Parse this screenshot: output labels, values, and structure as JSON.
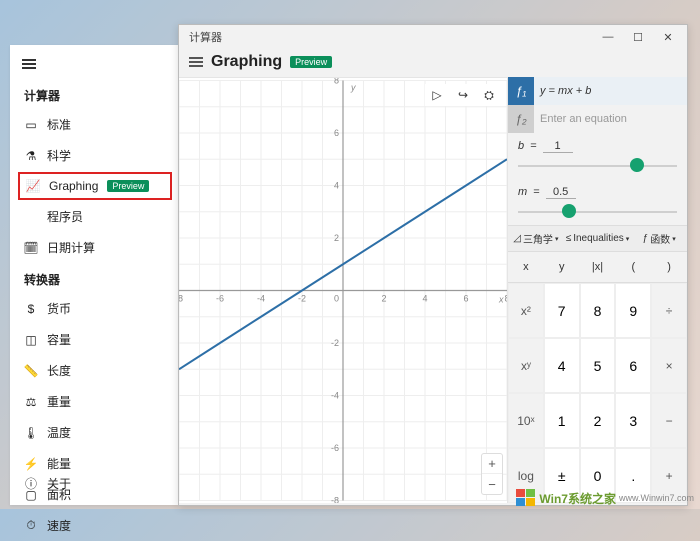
{
  "sidebar": {
    "title": "计算器",
    "items": [
      {
        "icon": "▭",
        "label": "标准",
        "sel": false
      },
      {
        "icon": "⚗",
        "label": "科学",
        "sel": false
      },
      {
        "icon": "📈",
        "label": "Graphing",
        "badge": "Preview",
        "sel": true
      },
      {
        "icon": "</>",
        "label": "程序员",
        "sel": false
      },
      {
        "icon": "🗓",
        "label": "日期计算",
        "sel": false
      }
    ],
    "converter_title": "转换器",
    "converters": [
      {
        "icon": "$",
        "label": "货币"
      },
      {
        "icon": "◫",
        "label": "容量"
      },
      {
        "icon": "📏",
        "label": "长度"
      },
      {
        "icon": "⚖",
        "label": "重量"
      },
      {
        "icon": "🌡",
        "label": "温度"
      },
      {
        "icon": "⚡",
        "label": "能量"
      },
      {
        "icon": "▢",
        "label": "面积"
      },
      {
        "icon": "⏱",
        "label": "速度"
      }
    ],
    "about": {
      "icon": "ⓘ",
      "label": "关于"
    }
  },
  "win": {
    "title": "计算器",
    "mode": "Graphing",
    "badge": "Preview",
    "min": "—",
    "max": "☐",
    "close": "✕"
  },
  "graph": {
    "tools": {
      "trace": "▷",
      "share": "↪",
      "settings": "⛭"
    },
    "zoom": {
      "in": "+",
      "out": "−"
    },
    "yaxis": "y",
    "xaxis": "x"
  },
  "equations": {
    "eq1": {
      "fn": "ƒ₁",
      "expr": "y = mx + b"
    },
    "eq2": {
      "fn": "ƒ₂",
      "placeholder": "Enter an equation"
    }
  },
  "sliders": {
    "b": {
      "name": "b",
      "eq": "=",
      "value": "1",
      "pos": 75
    },
    "m": {
      "name": "m",
      "eq": "=",
      "value": "0.5",
      "pos": 32
    }
  },
  "catbar": {
    "trig": {
      "icon": "◿",
      "label": "三角学"
    },
    "ineq": {
      "icon": "≤",
      "label": "Inequalities"
    },
    "func": {
      "icon": "ƒ",
      "label": "函数"
    }
  },
  "fnrow": [
    "x",
    "y",
    "|x|",
    "(",
    ")"
  ],
  "keypad": [
    [
      "x²",
      "7",
      "8",
      "9",
      "÷"
    ],
    [
      "xʸ",
      "4",
      "5",
      "6",
      "×"
    ],
    [
      "10ˣ",
      "1",
      "2",
      "3",
      "−"
    ],
    [
      "log",
      "±",
      "0",
      ".",
      "+"
    ]
  ],
  "chart_data": {
    "type": "line",
    "title": "",
    "xlabel": "x",
    "ylabel": "y",
    "xlim": [
      -8,
      8
    ],
    "ylim": [
      -8,
      8
    ],
    "ticks": [
      -8,
      -6,
      -4,
      -2,
      0,
      2,
      4,
      6,
      8
    ],
    "series": [
      {
        "name": "y = 0.5x + 1",
        "color": "#2d6fa7",
        "m": 0.5,
        "b": 1,
        "points": [
          [
            -8,
            -3
          ],
          [
            -6,
            -2
          ],
          [
            -4,
            -1
          ],
          [
            -2,
            0
          ],
          [
            0,
            1
          ],
          [
            2,
            2
          ],
          [
            4,
            3
          ],
          [
            6,
            4
          ],
          [
            8,
            5
          ]
        ]
      }
    ]
  },
  "watermark": {
    "brand": "Win7系统之家",
    "url": "www.Winwin7.com"
  }
}
